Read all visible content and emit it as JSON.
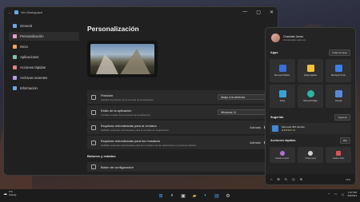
{
  "window": {
    "title": "Ver Workspace",
    "controls": [
      "—",
      "▢",
      "✕"
    ]
  },
  "sidebar": {
    "items": [
      {
        "label": "General",
        "color": "#6aa7e8"
      },
      {
        "label": "Personalización",
        "color": "#e3a0d0"
      },
      {
        "label": "Inicio",
        "color": "#f1a25c"
      },
      {
        "label": "Aplicaciones",
        "color": "#7cc7a5"
      },
      {
        "label": "Acciones rápidas",
        "color": "#e77f7f"
      },
      {
        "label": "Archivos recientes",
        "color": "#b79be8"
      },
      {
        "label": "Información",
        "color": "#6aa7e8"
      }
    ]
  },
  "main": {
    "title": "Personalización",
    "settings": [
      {
        "title": "Posición",
        "desc": "Cambia la posición de la ventana de la aplicación",
        "control": "dropdown",
        "value": "Abajo a la derecha"
      },
      {
        "title": "Estilo de la aplicación",
        "desc": "Cambia el estilo de la ventana de la aplicación",
        "control": "dropdown",
        "value": "Windows 11"
      },
      {
        "title": "Esquinas redondeadas para la ventana",
        "desc": "Habilitar esquinas redondeadas para la ventana de la aplicación",
        "control": "toggle",
        "value": "Activado"
      },
      {
        "title": "Esquinas redondeadas para los mosaicos",
        "desc": "Habilitar esquinas redondeadas para los mosaicos de las aplicaciones y acciones rápidas",
        "control": "toggle",
        "value": "Activado"
      }
    ],
    "section": "Botones y estados",
    "partial_row": "Botón de configuración"
  },
  "panel": {
    "user": {
      "name": "Charlotte Jones",
      "email": "charlotte@email.com"
    },
    "apps_label": "Apps",
    "apps_button": "Todas las Apps",
    "apps": [
      {
        "name": "Microsoft Whitel..",
        "color": "#3a6fd8"
      },
      {
        "name": "Notas rápidas",
        "color": "#f2c13a"
      },
      {
        "name": "Microsoft To Do",
        "color": "#3f7fe6"
      },
      {
        "name": "Fotos",
        "color": "#3aa0d6"
      },
      {
        "name": "Microsoft Edge",
        "color": "#2fb3a0"
      },
      {
        "name": "Journal",
        "color": "#5a88d8"
      }
    ],
    "suggest_label": "Sugerido",
    "suggest_button": "Siguiente",
    "suggestion": {
      "name": "Microsoft 365 Familia",
      "stars": "★★★★★ 4.5"
    },
    "actions_label": "Acciones rápidas",
    "actions_button": "Más",
    "actions": [
      {
        "name": "Grabar un pod..",
        "color": "#b070d8"
      },
      {
        "name": "Iniciar juego",
        "color": "#d0d0d0"
      },
      {
        "name": "Grabar video",
        "color": "#e05050"
      }
    ],
    "footer_icons": [
      "⌂",
      "⊞",
      "↻",
      "◷",
      "⚙"
    ],
    "battery": "73%"
  },
  "taskbar": {
    "weather_temp": "3°C",
    "weather_desc": "Cloudy",
    "icons": [
      {
        "name": "windows",
        "glyph": "⊞",
        "color": "#4aa3f0"
      },
      {
        "name": "search",
        "glyph": "⌕",
        "color": "#e0e0e0"
      },
      {
        "name": "task-view",
        "glyph": "▣",
        "color": "#cfcfcf"
      },
      {
        "name": "explorer",
        "glyph": "▰",
        "color": "#f0c44a"
      },
      {
        "name": "edge",
        "glyph": "◐",
        "color": "#38b6a8"
      },
      {
        "name": "store",
        "glyph": "▤",
        "color": "#4aa3f0"
      },
      {
        "name": "settings",
        "glyph": "⚙",
        "color": "#cfcfcf"
      }
    ],
    "time": "3:37 PM",
    "date": "5/9/2023"
  }
}
